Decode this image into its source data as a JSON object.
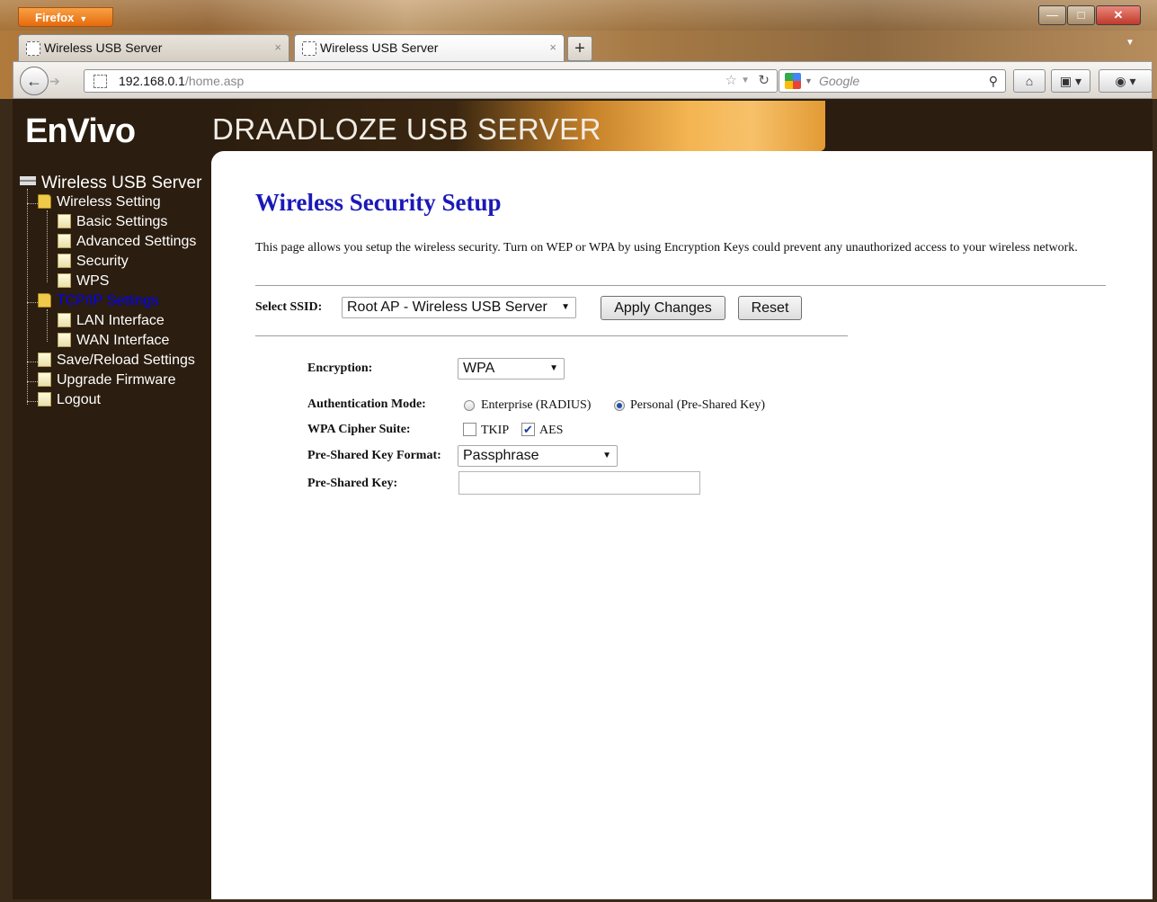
{
  "browser": {
    "app_button": "Firefox",
    "tabs": [
      {
        "title": "Wireless USB Server"
      },
      {
        "title": "Wireless USB Server"
      }
    ],
    "url_host": "192.168.0.1",
    "url_path": "/home.asp",
    "search_placeholder": "Google"
  },
  "header": {
    "logo": "EnVivo",
    "banner": "DRAADLOZE USB SERVER"
  },
  "sidebar": {
    "root": "Wireless USB Server",
    "items": [
      {
        "label": "Wireless Setting"
      },
      {
        "label": "Basic Settings"
      },
      {
        "label": "Advanced Settings"
      },
      {
        "label": "Security"
      },
      {
        "label": "WPS"
      },
      {
        "label": "TCP/IP Settings"
      },
      {
        "label": "LAN Interface"
      },
      {
        "label": "WAN Interface"
      },
      {
        "label": "Save/Reload Settings"
      },
      {
        "label": "Upgrade Firmware"
      },
      {
        "label": "Logout"
      }
    ],
    "active_color": "#0000ff"
  },
  "main": {
    "title": "Wireless Security Setup",
    "title_color": "#1b19b7",
    "description": "This page allows you setup the wireless security. Turn on WEP or WPA by using Encryption Keys could prevent any unauthorized access to your wireless network.",
    "ssid_label": "Select SSID:",
    "ssid_value": "Root AP - Wireless USB Server",
    "apply_label": "Apply Changes",
    "reset_label": "Reset",
    "encryption_label": "Encryption:",
    "encryption_value": "WPA",
    "auth_label": "Authentication Mode:",
    "auth_option_enterprise": "Enterprise (RADIUS)",
    "auth_option_personal": "Personal (Pre-Shared Key)",
    "auth_selected": "Personal (Pre-Shared Key)",
    "cipher_label": "WPA Cipher Suite:",
    "cipher_tkip": "TKIP",
    "cipher_tkip_checked": false,
    "cipher_aes": "AES",
    "cipher_aes_checked": true,
    "psk_format_label": "Pre-Shared Key Format:",
    "psk_format_value": "Passphrase",
    "psk_label": "Pre-Shared Key:",
    "psk_value": ""
  }
}
